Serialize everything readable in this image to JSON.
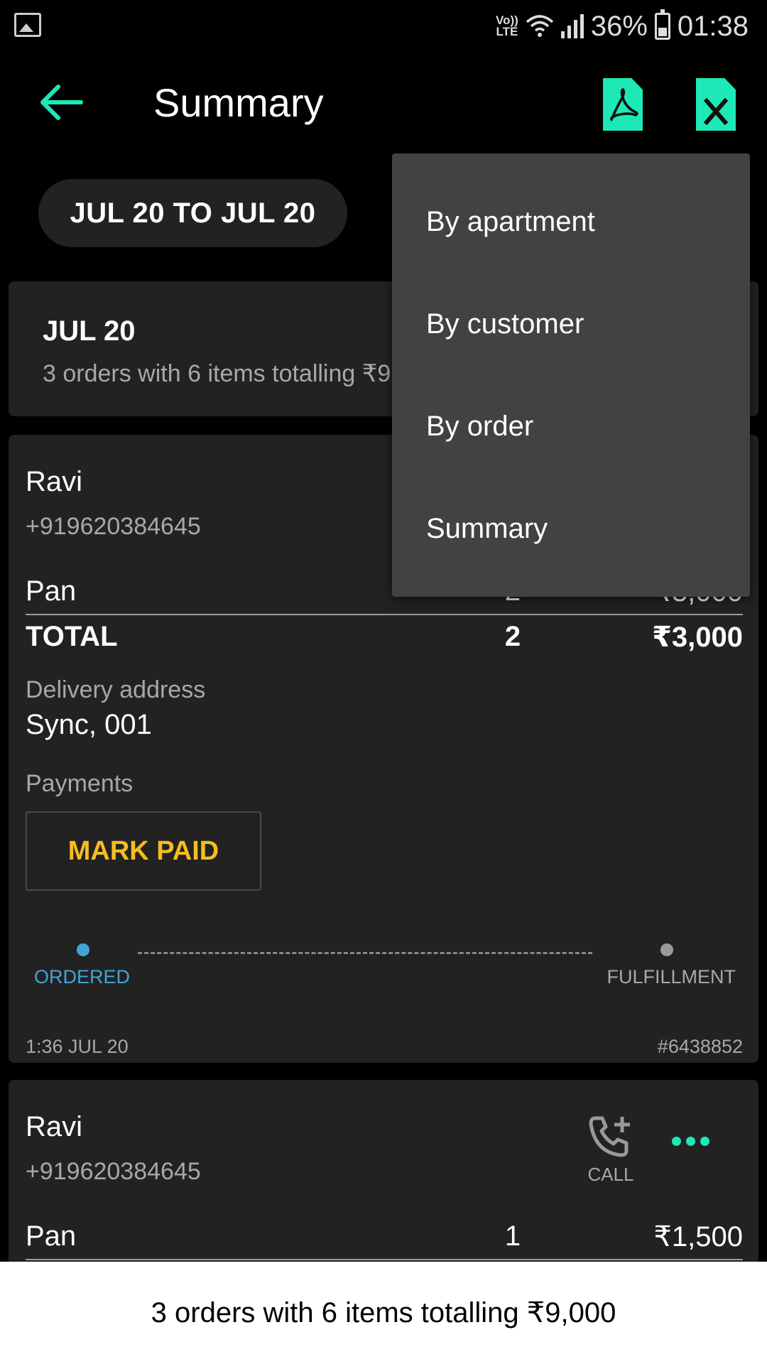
{
  "status_bar": {
    "volte_label": "Vo)) LTE",
    "battery_text": "36%",
    "time": "01:38"
  },
  "header": {
    "title": "Summary",
    "actions": [
      "pdf-export",
      "excel-export"
    ]
  },
  "date_filter": {
    "label": "JUL 20 TO JUL 20"
  },
  "day_summary": {
    "date": "JUL 20",
    "subtitle": "3 orders with 6 items totalling ₹9,000"
  },
  "order1": {
    "customer_name": "Ravi",
    "phone": "+919620384645",
    "items": [
      {
        "name": "Pan",
        "qty": "2",
        "amount": "₹3,000"
      }
    ],
    "total": {
      "label": "TOTAL",
      "qty": "2",
      "amount": "₹3,000"
    },
    "delivery_label": "Delivery address",
    "delivery_address": "Sync, 001",
    "payments_label": "Payments",
    "mark_paid_label": "MARK PAID",
    "steps": [
      {
        "label": "ORDERED",
        "active": true
      },
      {
        "label": "FULFILLMENT",
        "active": false
      }
    ],
    "timestamp": "1:36 JUL 20",
    "order_id": "#6438852"
  },
  "order2": {
    "customer_name": "Ravi",
    "phone": "+919620384645",
    "call_label": "CALL",
    "items": [
      {
        "name": "Pan",
        "qty": "1",
        "amount": "₹1,500"
      }
    ]
  },
  "menu": {
    "items": [
      "By apartment",
      "By customer",
      "By order",
      "Summary"
    ]
  },
  "footer": {
    "summary_text": "3 orders with 6 items totalling ₹9,000"
  },
  "colors": {
    "accent": "#1de9b6",
    "step_active": "#42a5d8",
    "mark_paid": "#f5bd1f",
    "card_bg": "#222222",
    "menu_bg": "#424242"
  }
}
